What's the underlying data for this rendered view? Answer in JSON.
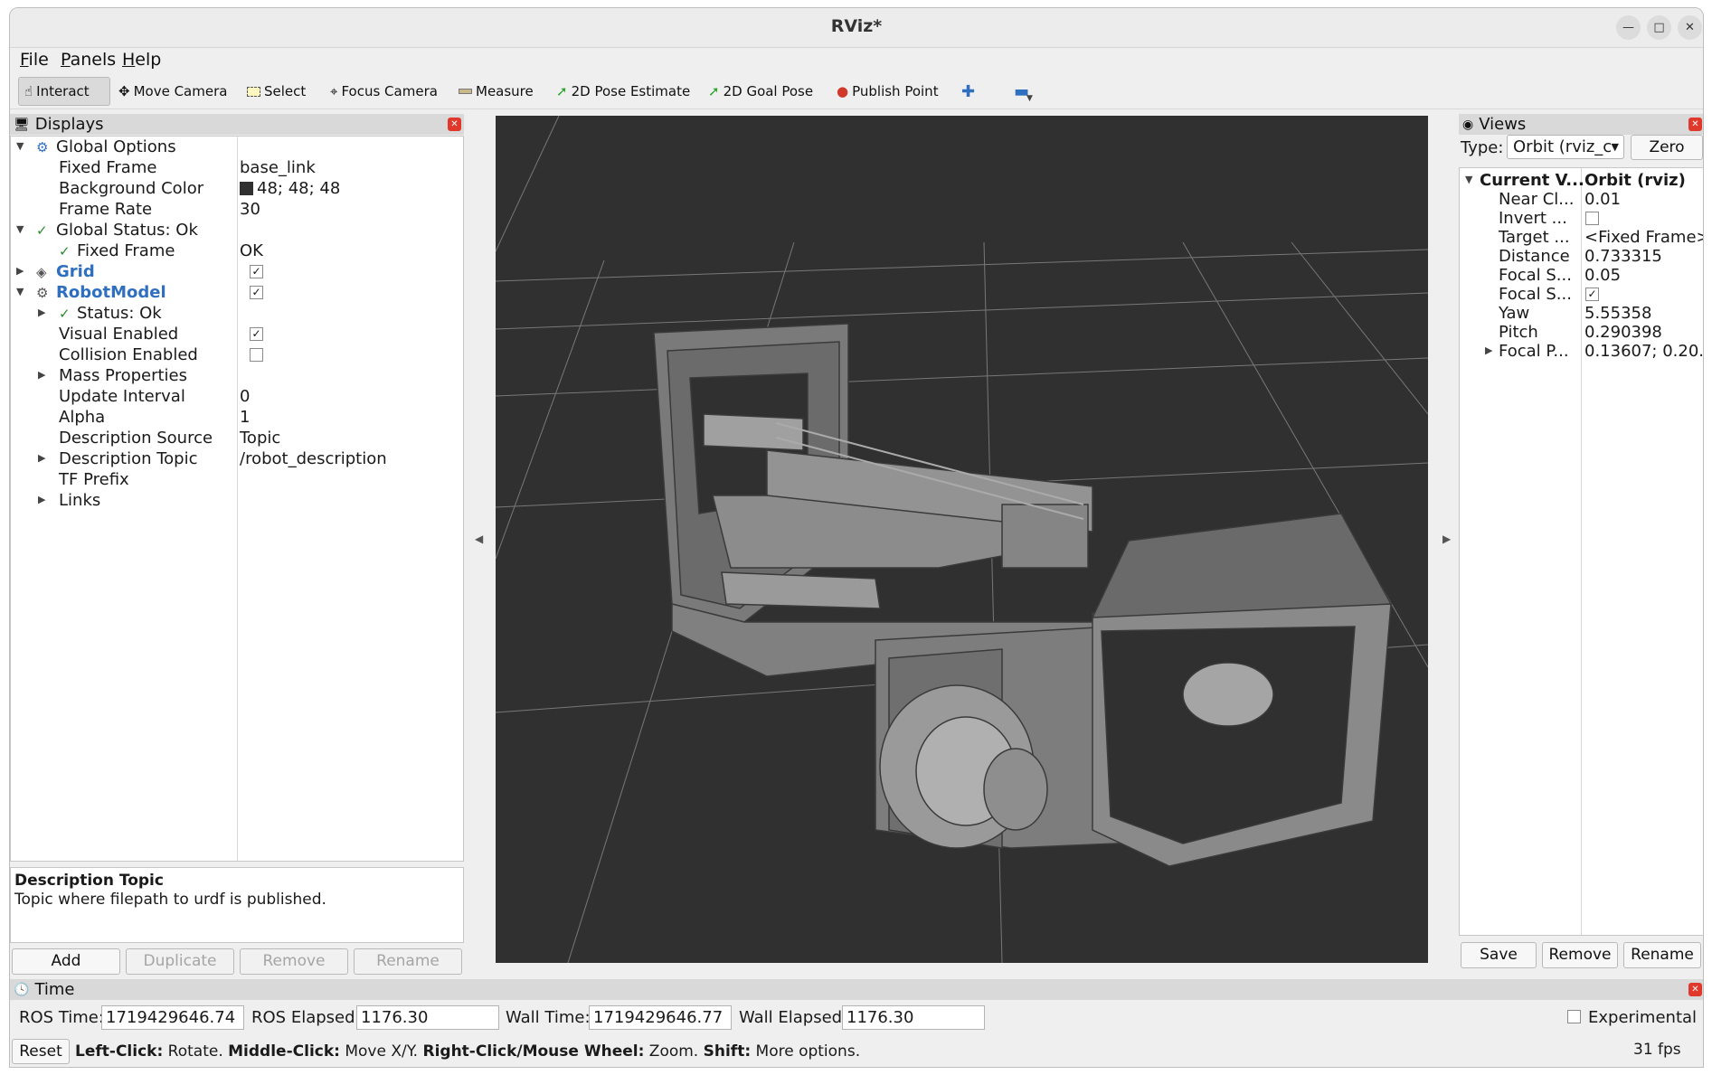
{
  "window": {
    "title": "RViz*"
  },
  "menu": [
    "File",
    "Panels",
    "Help"
  ],
  "toolbar": {
    "interact": "Interact",
    "move_camera": "Move Camera",
    "select": "Select",
    "focus_camera": "Focus Camera",
    "measure": "Measure",
    "pose_estimate": "2D Pose Estimate",
    "goal_pose": "2D Goal Pose",
    "publish_point": "Publish Point"
  },
  "displays": {
    "title": "Displays",
    "global_options": "Global Options",
    "fixed_frame_label": "Fixed Frame",
    "fixed_frame_value": "base_link",
    "bg_color_label": "Background Color",
    "bg_color_value": "48; 48; 48",
    "frame_rate_label": "Frame Rate",
    "frame_rate_value": "30",
    "global_status": "Global Status: Ok",
    "status_fixed_frame_label": "Fixed Frame",
    "status_fixed_frame_value": "OK",
    "grid": "Grid",
    "robot_model": "RobotModel",
    "status_ok": "Status: Ok",
    "visual_enabled": "Visual Enabled",
    "collision_enabled": "Collision Enabled",
    "mass_properties": "Mass Properties",
    "update_interval_label": "Update Interval",
    "update_interval_value": "0",
    "alpha_label": "Alpha",
    "alpha_value": "1",
    "desc_source_label": "Description Source",
    "desc_source_value": "Topic",
    "desc_topic_label": "Description Topic",
    "desc_topic_value": "/robot_description",
    "tf_prefix": "TF Prefix",
    "links": "Links",
    "help_title": "Description Topic",
    "help_text": "Topic where filepath to urdf is published.",
    "buttons": {
      "add": "Add",
      "duplicate": "Duplicate",
      "remove": "Remove",
      "rename": "Rename"
    }
  },
  "views": {
    "title": "Views",
    "type_label": "Type:",
    "type_value": "Orbit (rviz_c",
    "zero": "Zero",
    "rows": [
      {
        "k": "Current V...",
        "v": "Orbit (rviz)"
      },
      {
        "k": "Near Cl...",
        "v": "0.01"
      },
      {
        "k": "Invert ...",
        "v": ""
      },
      {
        "k": "Target ...",
        "v": "<Fixed Frame>"
      },
      {
        "k": "Distance",
        "v": "0.733315"
      },
      {
        "k": "Focal S...",
        "v": "0.05"
      },
      {
        "k": "Focal S...",
        "v": ""
      },
      {
        "k": "Yaw",
        "v": "5.55358"
      },
      {
        "k": "Pitch",
        "v": "0.290398"
      },
      {
        "k": "Focal P...",
        "v": "0.13607; 0.20..."
      }
    ],
    "buttons": {
      "save": "Save",
      "remove": "Remove",
      "rename": "Rename"
    }
  },
  "time": {
    "title": "Time",
    "ros_time_label": "ROS Time:",
    "ros_time_value": "1719429646.74",
    "ros_elapsed_label": "ROS Elapsed:",
    "ros_elapsed_value": "1176.30",
    "wall_time_label": "Wall Time:",
    "wall_time_value": "1719429646.77",
    "wall_elapsed_label": "Wall Elapsed:",
    "wall_elapsed_value": "1176.30",
    "experimental": "Experimental"
  },
  "status": {
    "reset": "Reset",
    "left_click": "Left-Click:",
    "rotate": "Rotate.",
    "middle_click": "Middle-Click:",
    "move_xy": "Move X/Y.",
    "right_click": "Right-Click/Mouse Wheel:",
    "zoom": "Zoom.",
    "shift": "Shift:",
    "more": "More options.",
    "fps": "31 fps"
  },
  "colors": {
    "viewport_bg": "#303030",
    "accent_blue": "#2f6fbf",
    "close_red": "#e0392b"
  },
  "icons": [
    "hand-icon",
    "move-camera-icon",
    "select-icon",
    "focus-camera-icon",
    "measure-icon",
    "pose-arrow-icon",
    "goal-arrow-icon",
    "map-pin-icon",
    "plus-icon",
    "minus-icon"
  ]
}
